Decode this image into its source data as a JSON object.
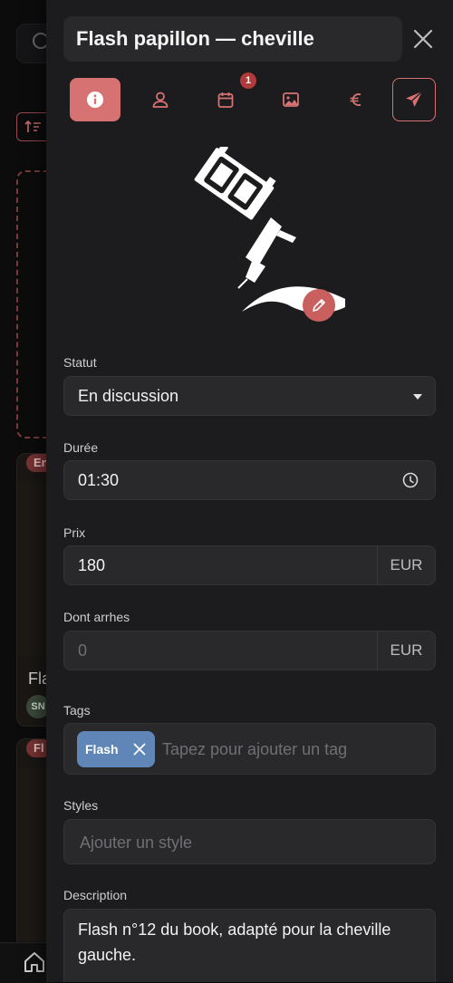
{
  "background": {
    "badge_1": "En",
    "badge_2": "Fl",
    "card_title": "Fla",
    "avatar_initials": "SN"
  },
  "drawer": {
    "title": "Flash papillon — cheville",
    "tabs": [
      {
        "name": "info",
        "icon": "info-icon"
      },
      {
        "name": "client",
        "icon": "user-icon"
      },
      {
        "name": "calendar",
        "icon": "calendar-icon",
        "badge": "1"
      },
      {
        "name": "images",
        "icon": "image-icon"
      },
      {
        "name": "price",
        "icon": "euro-icon"
      },
      {
        "name": "send",
        "icon": "send-icon"
      }
    ],
    "form": {
      "statut_label": "Statut",
      "statut_value": "En discussion",
      "duree_label": "Durée",
      "duree_value": "01:30",
      "prix_label": "Prix",
      "prix_value": "180",
      "prix_currency": "EUR",
      "arrhes_label": "Dont arrhes",
      "arrhes_placeholder": "0",
      "arrhes_currency": "EUR",
      "tags_label": "Tags",
      "tags": [
        "Flash"
      ],
      "tags_placeholder": "Tapez pour ajouter un tag",
      "styles_label": "Styles",
      "styles_placeholder": "Ajouter un style",
      "description_label": "Description",
      "description_value": "Flash n°12 du book, adapté pour la cheville gauche."
    }
  },
  "colors": {
    "accent": "#d77272",
    "tag": "#5f86b6",
    "badge": "#b33a3a"
  }
}
